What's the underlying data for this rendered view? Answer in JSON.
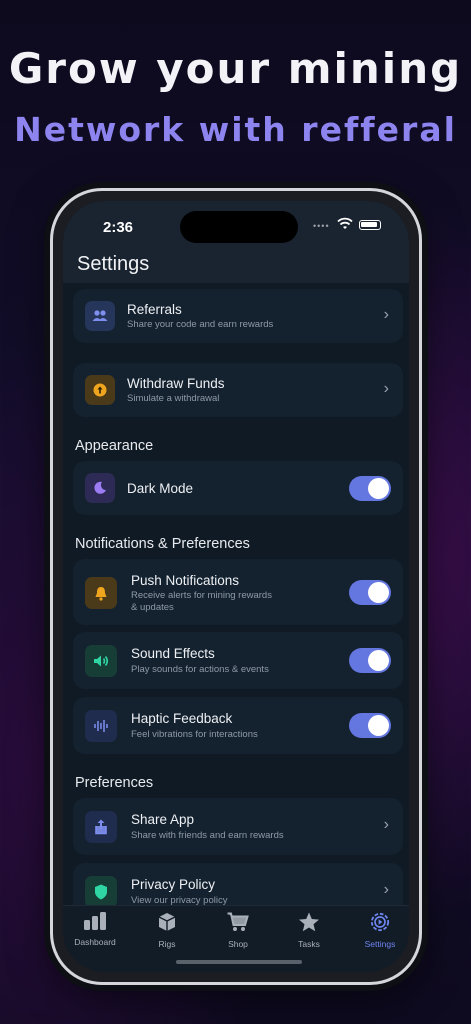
{
  "headline": {
    "line1": "Grow your mining",
    "line2": "Network with refferal"
  },
  "status": {
    "time": "2:36"
  },
  "nav": {
    "title": "Settings"
  },
  "items": {
    "referrals": {
      "title": "Referrals",
      "subtitle": "Share your code and earn rewards"
    },
    "withdraw": {
      "title": "Withdraw Funds",
      "subtitle": "Simulate a withdrawal"
    },
    "dark_mode": {
      "title": "Dark Mode",
      "on": true
    },
    "push": {
      "title": "Push Notifications",
      "subtitle": "Receive alerts for mining rewards\n& updates",
      "on": true
    },
    "sound": {
      "title": "Sound Effects",
      "subtitle": "Play sounds for actions & events",
      "on": true
    },
    "haptic": {
      "title": "Haptic Feedback",
      "subtitle": "Feel vibrations for interactions",
      "on": true
    },
    "share": {
      "title": "Share App",
      "subtitle": "Share with friends and earn rewards"
    },
    "privacy": {
      "title": "Privacy Policy",
      "subtitle": "View our privacy policy"
    }
  },
  "sections": {
    "appearance": "Appearance",
    "notifications": "Notifications & Preferences",
    "preferences": "Preferences"
  },
  "tabs": [
    {
      "label": "Dashboard",
      "icon": "bar-chart-icon"
    },
    {
      "label": "Rigs",
      "icon": "cube-icon"
    },
    {
      "label": "Shop",
      "icon": "cart-icon"
    },
    {
      "label": "Tasks",
      "icon": "star-icon"
    },
    {
      "label": "Settings",
      "icon": "gear-icon",
      "active": true
    }
  ],
  "colors": {
    "accent": "#6476e0",
    "active_tab": "#6f85f2",
    "headline2": "#8e84f0"
  }
}
